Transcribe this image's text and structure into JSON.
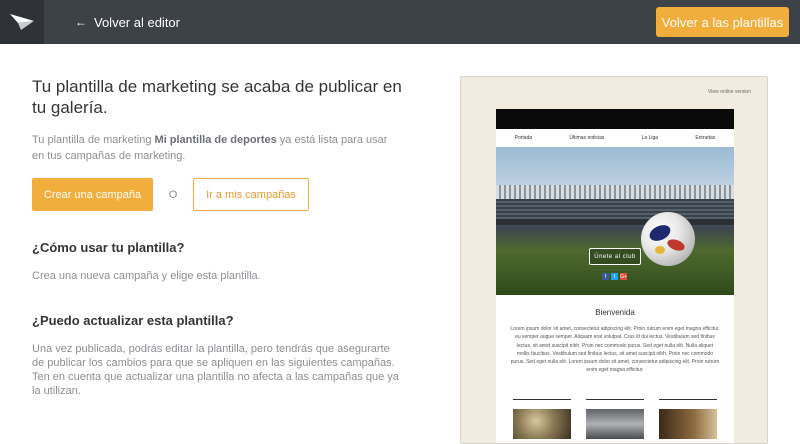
{
  "topbar": {
    "back_label": "Volver al editor",
    "templates_button": "Volver a las plantillas"
  },
  "main": {
    "headline": "Tu plantilla de marketing se acaba de publicar en tu galería.",
    "intro_before": "Tu plantilla de marketing ",
    "template_name": "Mi plantilla de deportes",
    "intro_after": " ya está lista para usar en tus campañas de marketing.",
    "create_button": "Crear una campaña",
    "or_text": "O",
    "campaigns_button": "Ir a mis campañas",
    "faq": [
      {
        "question": "¿Cómo usar tu plantilla?",
        "answer": "Crea una nueva campaña y elige esta plantilla."
      },
      {
        "question": "¿Puedo actualizar esta plantilla?",
        "answer": "Una vez publicada, podrás editar la plantilla, pero tendrás que asegurarte de publicar los cambios para que se apliquen en las siguientes campañas. Ten en cuenta que actualizar una plantilla no afecta a las campañas que ya la utilizan."
      }
    ]
  },
  "preview": {
    "view_online": "View online version",
    "nav": [
      "Portada",
      "Últimas noticias",
      "La Liga",
      "Entradas"
    ],
    "join_button": "Únete al club",
    "socials": [
      "f",
      "t",
      "G+"
    ],
    "welcome_title": "Bienvenida",
    "body_text": "Lorem ipsum dolor sit amet, consectetur adipiscing elit. Proin rutrum enim eget magna efficitur, eu semper augue semper. Aliquam erat volutpat. Cras id dui lectus. Vestibulum sed finibus lectus, sit amet suscipit nibh. Proin nec commodo purus. Sed eget nulla elit. Nulla aliquet mollis faucibus. Vestibulum sed finibus lectus, sit amet suscipit nibh. Proin nec commodo purus. Sed eget nulla elit. Lorem ipsum dolor sit amet, consectetur adipiscing elit. Proin rutrum enim eget magna efficitur."
  },
  "colors": {
    "accent": "#f2ae3d",
    "topbar": "#3d4148",
    "preview_bg": "#f2ebe0"
  }
}
